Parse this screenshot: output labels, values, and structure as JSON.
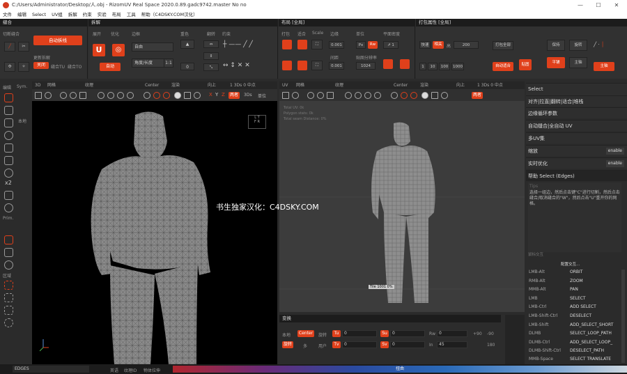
{
  "window": {
    "title": "C:/Users/Administrator/Desktop/人.obj  - RizomUV  Real Space 2020.0.89.gadc9742.master No no"
  },
  "menu": [
    "文件",
    "编辑",
    "Select",
    "UV组",
    "拆解",
    "约束",
    "实验",
    "布局",
    "工具",
    "帮助（C4DSKY.COM汉化）"
  ],
  "panels": {
    "stitch": "缝合",
    "unfold": "拆解",
    "layout": "布局 [全局]",
    "pack_props": "打包属性 [全局]"
  },
  "toolbar": {
    "cut_stitch": "切断缝合",
    "auto_seam": "自动拆线",
    "seam_labels": [
      "更新拆解",
      "关闭",
      "缝合TU",
      "缝合TO"
    ],
    "unfold_labels": [
      "展开",
      "优化",
      "边框",
      "重色",
      "翻转",
      "约束"
    ],
    "unfold_value": "自动",
    "select_value": "自由",
    "mode_value": "角度/长度",
    "ratio": "1:1",
    "iter_value": "0",
    "unfold_btn": "自动",
    "layout_labels": [
      "打包",
      "适合",
      "Scale",
      "边缘",
      "单位",
      "平面密度"
    ],
    "margin1": "0.001",
    "margin2": "0.001",
    "unit_px": "Px",
    "unit_sel": "Rw",
    "map_res": "1024",
    "spacing_label": "间距",
    "density_label": "贴图分辨率",
    "pack_props": {
      "quality": "快速",
      "mode": "相关",
      "fast": "高",
      "res": "200",
      "iter1": "1",
      "iter2": "10",
      "iter3": "100",
      "iter4": "1000",
      "btn_pack": "打包全部",
      "btn_auto": "自动适合",
      "btn_fit": "贴图",
      "btn_keep": "保持",
      "btn_rot": "旋转",
      "btn_flip": "平铺",
      "btn_tile": "主轴"
    }
  },
  "viewport_left": {
    "header": [
      "3D",
      "网格",
      "纹理",
      "Center",
      "渲染",
      "向上"
    ],
    "right_info": "1 3Ds 0 中点",
    "axis": [
      "X",
      "Y",
      "Z"
    ],
    "mode": "两者",
    "dims": "3Ds",
    "unit": "单位"
  },
  "viewport_right": {
    "header": [
      "UV",
      "网格",
      "纹理",
      "Center",
      "渲染",
      "向上"
    ],
    "right_info": "1 3Ds 0 中点",
    "mode": "两者",
    "stats": [
      "Total UV: 0k",
      "Polygon stats: 0k",
      "Total seam Distance: 0%"
    ],
    "tile_label": "Tile 1001 0%"
  },
  "transform": {
    "title": "变换",
    "row1": [
      "本地",
      "Center",
      "旋转",
      "Tu",
      "0",
      "Su",
      "0",
      "Rw",
      "0",
      "+90",
      "-90"
    ],
    "row2": [
      "旋转",
      "多",
      "用户",
      "Tv",
      "0",
      "Sv",
      "0",
      "In",
      "45",
      "180"
    ]
  },
  "right_panel": {
    "select": "Select",
    "rows": [
      "对齐|拉直|翻转|适合|堆栈",
      "边缘循环参数",
      "自动缝合|全自动 UV",
      "多UV集",
      "缩放",
      "实时优化"
    ],
    "enable": "enable",
    "help_title": "帮助 Select (Edges)",
    "tips_title": "Tips",
    "tips": "选择一组边，然后点击键\"C\"进行切割，然后点击缝合/取消缝合的\"W\"，然后点击\"U\"重开你的网格。",
    "mouse_title": "鼠标交互",
    "config": "配置交互...",
    "bindings": [
      {
        "k": "LMB-Alt",
        "v": "ORBIT"
      },
      {
        "k": "RMB-Alt",
        "v": "ZOOM"
      },
      {
        "k": "MMB-Alt",
        "v": "PAN"
      },
      {
        "k": "LMB",
        "v": "SELECT"
      },
      {
        "k": "LMB-Ctrl",
        "v": "ADD SELECT"
      },
      {
        "k": "LMB-Shift-Ctrl",
        "v": "DESELECT"
      },
      {
        "k": "LMB-Shift",
        "v": "ADD_SELECT_SHORT"
      },
      {
        "k": "DLMB",
        "v": "SELECT_LOOP_PATH"
      },
      {
        "k": "DLMB-Ctrl",
        "v": "ADD_SELECT_LOOP_"
      },
      {
        "k": "DLMB-Shift-Ctrl",
        "v": "DESELECT_PATH"
      },
      {
        "k": "MMB-Space",
        "v": "SELECT TRANSLATE"
      }
    ]
  },
  "left_sidebar": {
    "header": [
      "编辑",
      "Sym."
    ],
    "local": "本地",
    "x2": "x2",
    "prim": "Prim.",
    "area": "区域"
  },
  "status": {
    "mode": "EDGES",
    "items": [
      "英语",
      "纹理ID",
      "物体拉伸"
    ],
    "center": "扭曲"
  },
  "watermark": "书生独家汉化：C4DSKY.COM",
  "colors": {
    "accent": "#e0401b",
    "bg": "#2b2b2b",
    "viewport": "#000000"
  }
}
